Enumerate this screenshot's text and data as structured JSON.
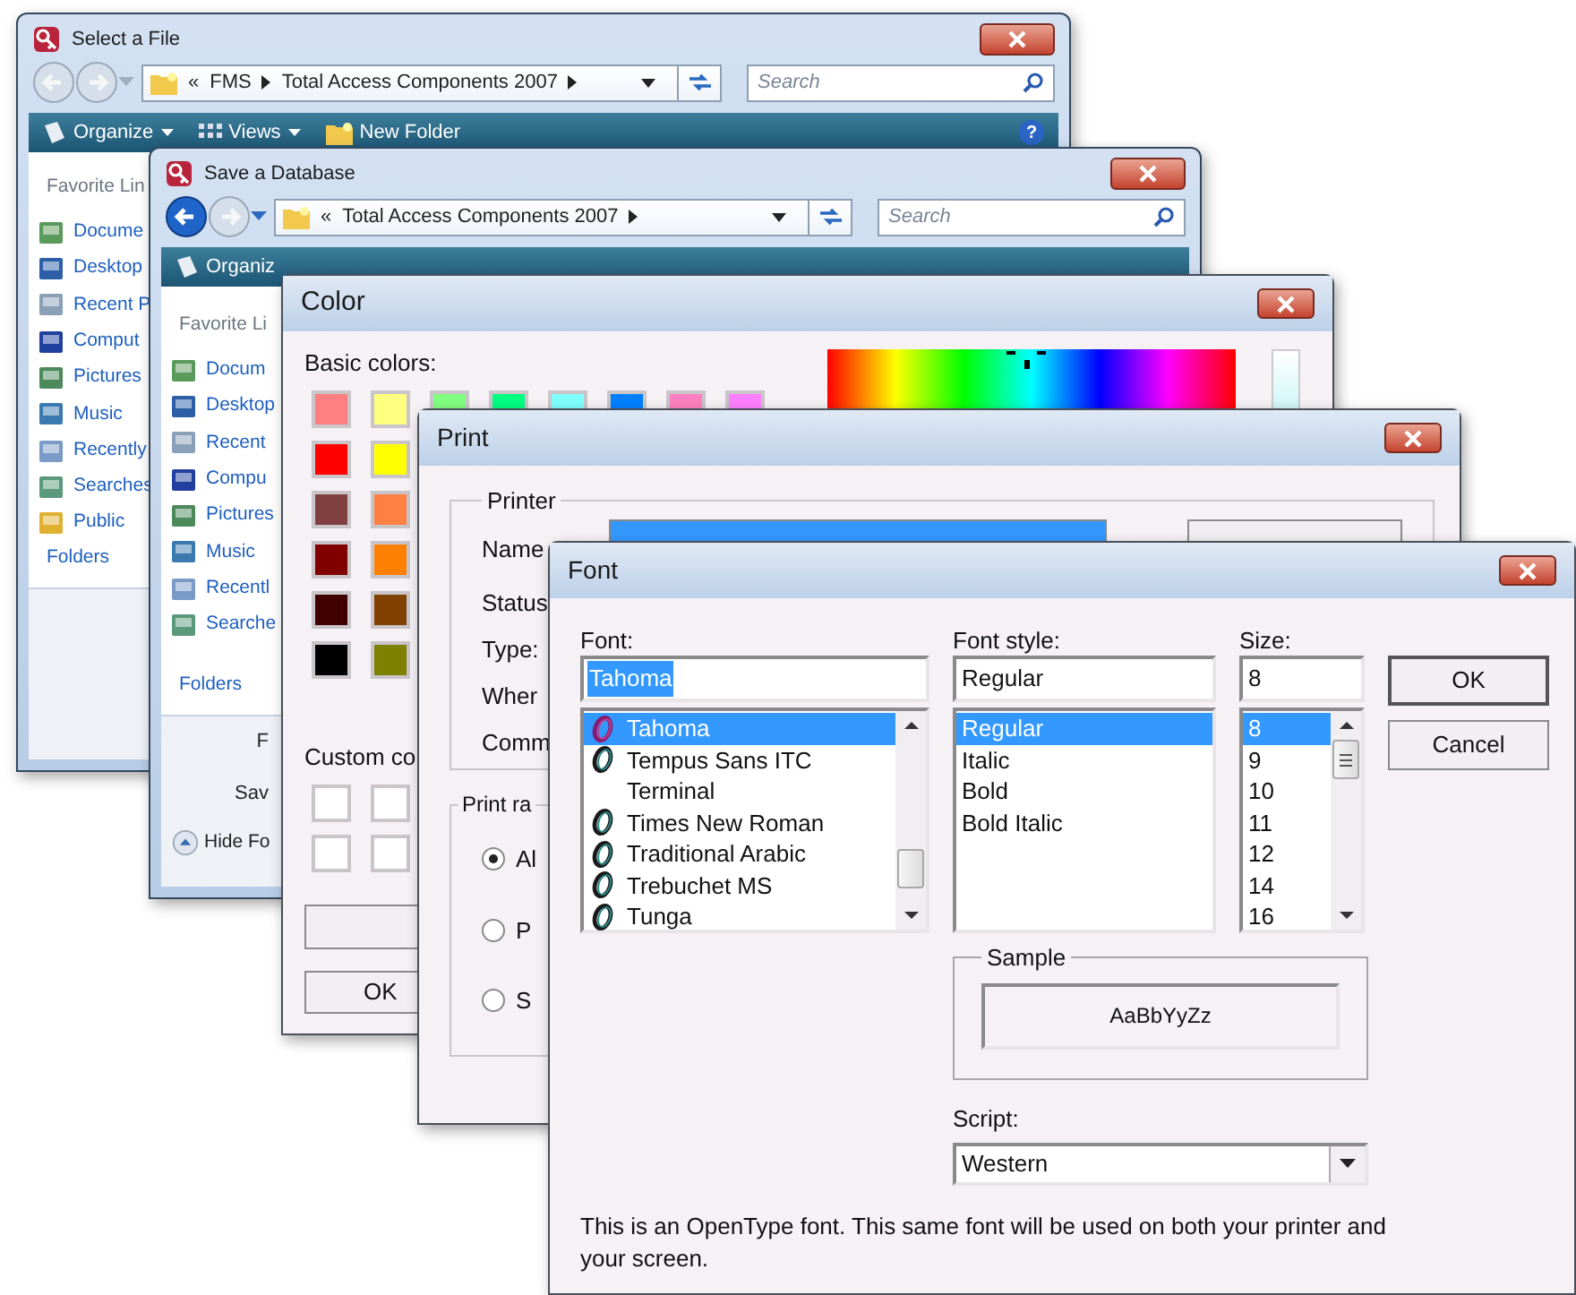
{
  "select_file_window": {
    "title": "Select a File",
    "back_enabled": false,
    "overflow_mark": "«",
    "crumbs": [
      "FMS",
      "Total Access Components 2007"
    ],
    "search_placeholder": "Search",
    "toolbar": [
      {
        "label": "Organize",
        "menu": true
      },
      {
        "label": "Views",
        "menu": true
      },
      {
        "label": "New Folder",
        "menu": false
      }
    ],
    "help_mark": "?",
    "nav_heading": "Favorite Lin",
    "nav_items": [
      "Docume",
      "Desktop",
      "Recent P",
      "Comput",
      "Pictures",
      "Music",
      "Recently",
      "Searches",
      "Public"
    ],
    "folders_label": "Folders"
  },
  "save_database_window": {
    "title": "Save a Database",
    "back_enabled": true,
    "overflow_mark": "«",
    "crumbs": [
      "Total Access Components 2007"
    ],
    "search_placeholder": "Search",
    "toolbar": [
      {
        "label": "Organiz",
        "menu": false
      }
    ],
    "nav_heading": "Favorite Li",
    "nav_items": [
      "Docum",
      "Desktop",
      "Recent",
      "Compu",
      "Pictures",
      "Music",
      "Recentl",
      "Searche"
    ],
    "folders_label": "Folders",
    "footer_labels": [
      "F",
      "Sav"
    ],
    "hide_button": "Hide Fo"
  },
  "color_window": {
    "title": "Color",
    "basic_label": "Basic colors:",
    "basic_colors": [
      [
        {
          "color": "#ff8080"
        },
        {
          "color": "#ffff80"
        },
        {
          "color": "#80ff80"
        },
        {
          "color": "#00ff80"
        },
        {
          "color": "#80ffff"
        },
        {
          "color": "#0080ff"
        },
        {
          "color": "#ff80c0"
        },
        {
          "color": "#ff80ff"
        }
      ],
      [
        {
          "color": "#ff0000"
        },
        {
          "color": "#ffff00"
        }
      ],
      [
        {
          "color": "#804040"
        },
        {
          "color": "#ff8040"
        }
      ],
      [
        {
          "color": "#800000"
        },
        {
          "color": "#ff8000"
        }
      ],
      [
        {
          "color": "#400000"
        },
        {
          "color": "#804000"
        }
      ],
      [
        {
          "color": "#000000"
        },
        {
          "color": "#808000"
        }
      ]
    ],
    "custom_label": "Custom co",
    "ok_button": "OK"
  },
  "print_window": {
    "title": "Print",
    "printer_group": "Printer",
    "printer_labels": [
      "Name",
      "Status",
      "Type:",
      "Wher",
      "Comm"
    ],
    "range_group": "Print ra",
    "range_options": [
      {
        "label": "Al",
        "selected": true
      },
      {
        "label": "P",
        "selected": false
      },
      {
        "label": "S",
        "selected": false
      }
    ]
  },
  "font_window": {
    "title": "Font",
    "font": {
      "label": "Font:",
      "value": "Tahoma",
      "value_highlighted": true,
      "items": [
        {
          "name": "Tahoma",
          "icon": true,
          "selected": true
        },
        {
          "name": "Tempus Sans ITC",
          "icon": true,
          "selected": false
        },
        {
          "name": "Terminal",
          "icon": false,
          "selected": false
        },
        {
          "name": "Times New Roman",
          "icon": true,
          "selected": false
        },
        {
          "name": "Traditional Arabic",
          "icon": true,
          "selected": false
        },
        {
          "name": "Trebuchet MS",
          "icon": true,
          "selected": false
        },
        {
          "name": "Tunga",
          "icon": true,
          "selected": false
        }
      ]
    },
    "style": {
      "label": "Font style:",
      "value": "Regular",
      "items": [
        {
          "name": "Regular",
          "selected": true
        },
        {
          "name": "Italic",
          "selected": false
        },
        {
          "name": "Bold",
          "selected": false
        },
        {
          "name": "Bold Italic",
          "selected": false
        }
      ]
    },
    "size": {
      "label": "Size:",
      "value": "8",
      "items": [
        {
          "name": "8",
          "selected": true
        },
        {
          "name": "9",
          "selected": false
        },
        {
          "name": "10",
          "selected": false
        },
        {
          "name": "11",
          "selected": false
        },
        {
          "name": "12",
          "selected": false
        },
        {
          "name": "14",
          "selected": false
        },
        {
          "name": "16",
          "selected": false
        }
      ]
    },
    "buttons": [
      {
        "label": "OK",
        "default": true
      },
      {
        "label": "Cancel",
        "default": false
      }
    ],
    "sample_label": "Sample",
    "sample_text": "AaBbYyZz",
    "script_label": "Script:",
    "script_value": "Western",
    "note": "This is an OpenType font. This same font will be used on both your printer and your screen."
  }
}
